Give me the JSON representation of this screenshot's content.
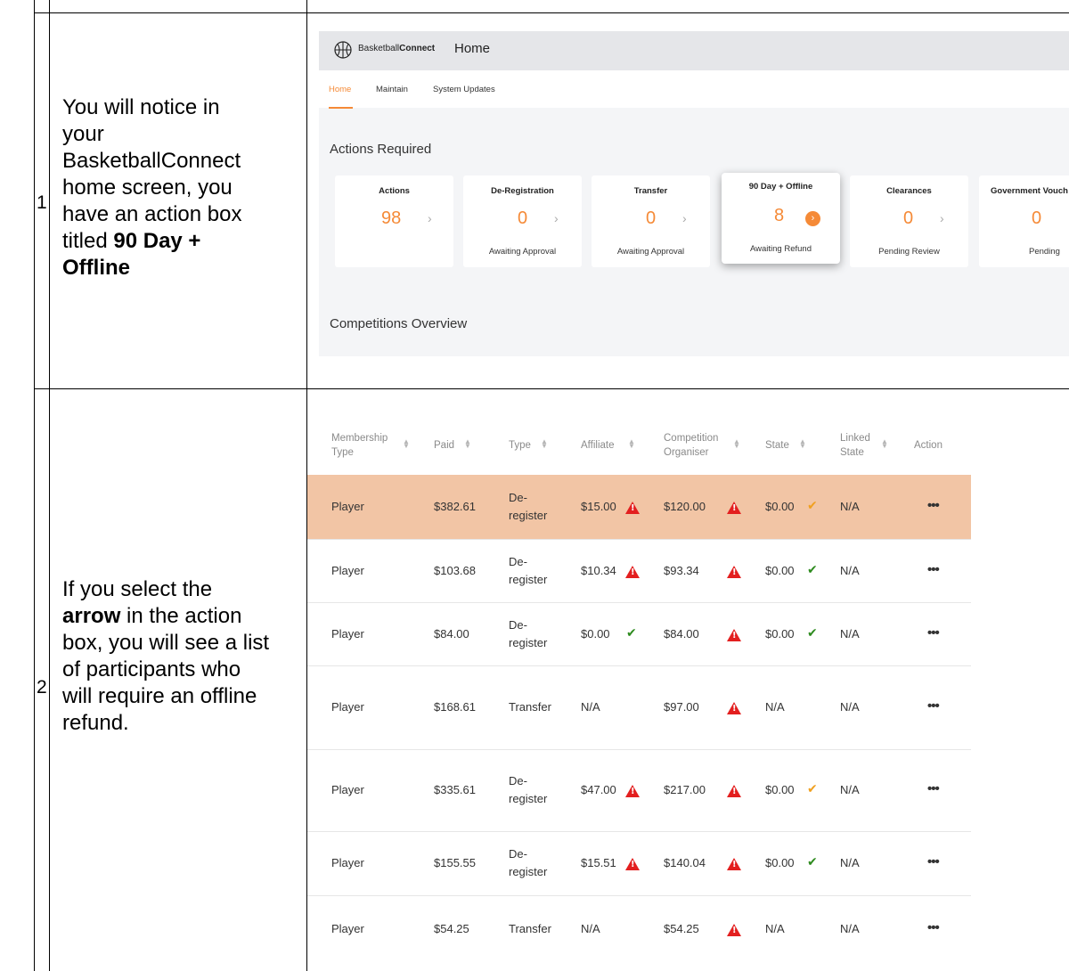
{
  "steps": [
    {
      "number": "1",
      "text_lines": [
        "You will notice in",
        "your",
        "BasketballConnect",
        "home screen, you",
        "have an action box"
      ],
      "text_prefix": "titled ",
      "text_bold_1": "90 Day +",
      "text_bold_2": "Offline"
    },
    {
      "number": "2",
      "text_line1": "If you select the",
      "text_bold": "arrow",
      "text_after_bold": " in the action",
      "text_lines": [
        "box, you will see a list",
        "of participants who",
        "will require an offline",
        "refund."
      ]
    }
  ],
  "screenshot1": {
    "brand_regular": "Basketball",
    "brand_bold": "Connect",
    "page_title": "Home",
    "tabs": [
      "Home",
      "Maintain",
      "System Updates"
    ],
    "active_tab": "Home",
    "actions_title": "Actions Required",
    "cards": [
      {
        "title": "Actions",
        "value": "98",
        "subtitle": ""
      },
      {
        "title": "De-Registration",
        "value": "0",
        "subtitle": "Awaiting Approval"
      },
      {
        "title": "Transfer",
        "value": "0",
        "subtitle": "Awaiting Approval"
      },
      {
        "title": "90 Day + Offline",
        "value": "8",
        "subtitle": "Awaiting Refund"
      },
      {
        "title": "Clearances",
        "value": "0",
        "subtitle": "Pending Review"
      },
      {
        "title": "Government Vouch",
        "value": "0",
        "subtitle": "Pending"
      }
    ],
    "competitions_title": "Competitions Overview",
    "accent_color": "#f58a37",
    "icons": [
      "basketball-icon",
      "chevron-right-icon",
      "arrow-circle-icon"
    ]
  },
  "screenshot2": {
    "headers": [
      {
        "line1": "Membership",
        "line2": "Type"
      },
      {
        "line1": "Paid",
        "line2": ""
      },
      {
        "line1": "Type",
        "line2": ""
      },
      {
        "line1": "Affiliate",
        "line2": ""
      },
      {
        "line1": "Competition",
        "line2": "Organiser"
      },
      {
        "line1": "State",
        "line2": ""
      },
      {
        "line1": "Linked",
        "line2": "State"
      },
      {
        "line1": "Action",
        "line2": ""
      }
    ],
    "rows": [
      {
        "membership": "Player",
        "paid": "$382.61",
        "type1": "De-",
        "type2": "register",
        "affiliate": "$15.00",
        "affiliate_status": "warning",
        "organiser": "$120.00",
        "organiser_status": "warning",
        "state": "$0.00",
        "state_status": "check-orange",
        "linked_state": "N/A",
        "highlighted": true
      },
      {
        "membership": "Player",
        "paid": "$103.68",
        "type1": "De-",
        "type2": "register",
        "affiliate": "$10.34",
        "affiliate_status": "warning",
        "organiser": "$93.34",
        "organiser_status": "warning",
        "state": "$0.00",
        "state_status": "check-green",
        "linked_state": "N/A",
        "highlighted": false
      },
      {
        "membership": "Player",
        "paid": "$84.00",
        "type1": "De-",
        "type2": "register",
        "affiliate": "$0.00",
        "affiliate_status": "check-green",
        "organiser": "$84.00",
        "organiser_status": "warning",
        "state": "$0.00",
        "state_status": "check-green",
        "linked_state": "N/A",
        "highlighted": false
      },
      {
        "membership": "Player",
        "paid": "$168.61",
        "type1": "Transfer",
        "type2": "",
        "affiliate": "N/A",
        "affiliate_status": "none",
        "organiser": "$97.00",
        "organiser_status": "warning",
        "state": "N/A",
        "state_status": "none",
        "linked_state": "N/A",
        "highlighted": false
      },
      {
        "membership": "Player",
        "paid": "$335.61",
        "type1": "De-",
        "type2": "register",
        "affiliate": "$47.00",
        "affiliate_status": "warning",
        "organiser": "$217.00",
        "organiser_status": "warning",
        "state": "$0.00",
        "state_status": "check-orange",
        "linked_state": "N/A",
        "highlighted": false
      },
      {
        "membership": "Player",
        "paid": "$155.55",
        "type1": "De-",
        "type2": "register",
        "affiliate": "$15.51",
        "affiliate_status": "warning",
        "organiser": "$140.04",
        "organiser_status": "warning",
        "state": "$0.00",
        "state_status": "check-green",
        "linked_state": "N/A",
        "highlighted": false
      },
      {
        "membership": "Player",
        "paid": "$54.25",
        "type1": "Transfer",
        "type2": "",
        "affiliate": "N/A",
        "affiliate_status": "none",
        "organiser": "$54.25",
        "organiser_status": "warning",
        "state": "N/A",
        "state_status": "none",
        "linked_state": "N/A",
        "highlighted": false
      }
    ],
    "action_label": "•••",
    "status_colors": {
      "warning": "#e31f1f",
      "check-green": "#2e8b1f",
      "check-orange": "#f0a020",
      "highlight": "#f2c5a5"
    }
  }
}
